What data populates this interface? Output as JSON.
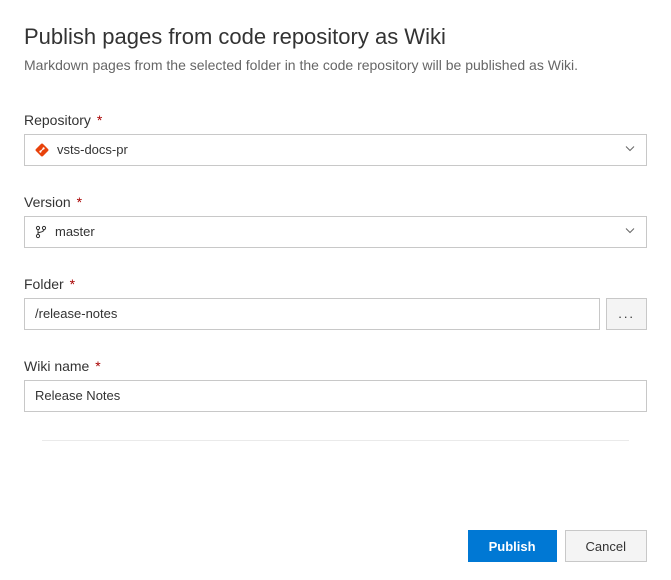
{
  "header": {
    "title": "Publish pages from code repository as Wiki",
    "description": "Markdown pages from the selected folder in the code repository will be published as Wiki."
  },
  "fields": {
    "repository": {
      "label": "Repository",
      "required": "*",
      "value": "vsts-docs-pr"
    },
    "version": {
      "label": "Version",
      "required": "*",
      "value": "master"
    },
    "folder": {
      "label": "Folder",
      "required": "*",
      "value": "/release-notes",
      "browse_label": "..."
    },
    "wiki_name": {
      "label": "Wiki name",
      "required": "*",
      "value": "Release Notes"
    }
  },
  "buttons": {
    "publish": "Publish",
    "cancel": "Cancel"
  }
}
